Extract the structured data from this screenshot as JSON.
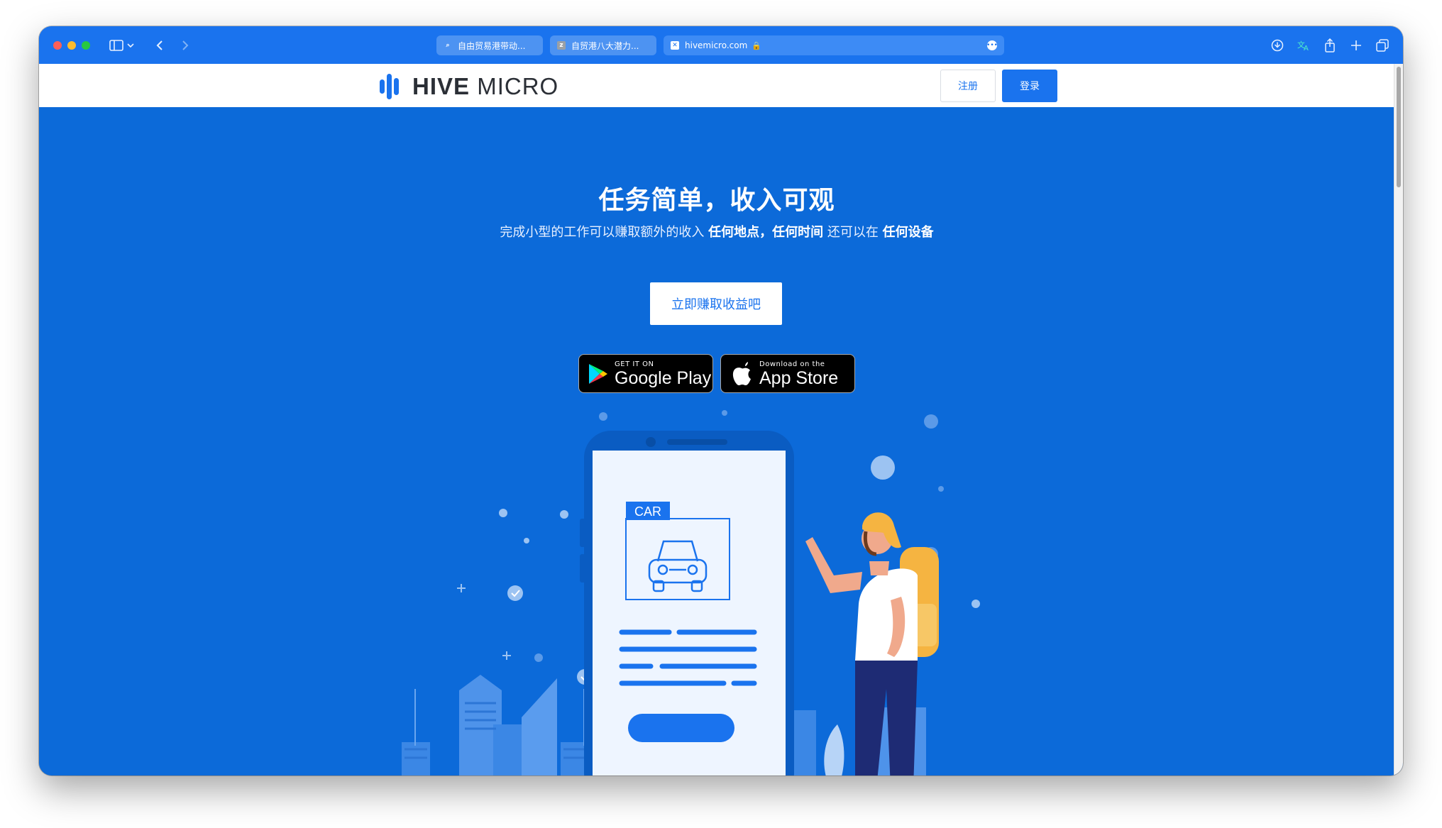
{
  "browser": {
    "tabs": [
      {
        "label": "自由贸易港带动..."
      },
      {
        "label": "自贸港八大潜力..."
      }
    ],
    "address": "hivemicro.com"
  },
  "header": {
    "logo_bold": "HIVE",
    "logo_light": "MICRO",
    "register_label": "注册",
    "login_label": "登录"
  },
  "hero": {
    "title": "任务简单，收入可观",
    "subtitle_prefix": "完成小型的工作可以赚取额外的收入 ",
    "subtitle_bold1": "任何地点，任何时间",
    "subtitle_mid": " 还可以在 ",
    "subtitle_bold2": "任何设备",
    "cta_label": "立即赚取收益吧",
    "google_play": {
      "small": "GET IT ON",
      "big": "Google Play"
    },
    "app_store": {
      "small": "Download on the",
      "big": "App Store"
    },
    "card_tag": "CAR"
  },
  "colors": {
    "hero_bg": "#0c6ad9",
    "accent": "#1a73ee",
    "toolbar": "#1a73ee"
  }
}
